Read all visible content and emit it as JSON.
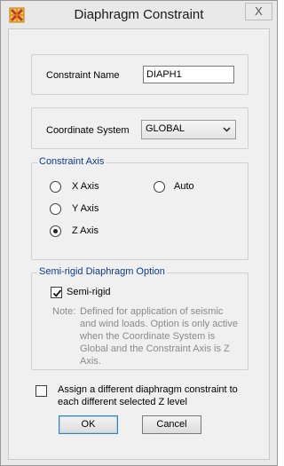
{
  "window": {
    "title": "Diaphragm Constraint",
    "close_glyph": "X",
    "icon": "app-icon"
  },
  "constraint_name": {
    "label": "Constraint Name",
    "value": "DIAPH1"
  },
  "coordinate_system": {
    "label": "Coordinate System",
    "selected": "GLOBAL"
  },
  "constraint_axis": {
    "title": "Constraint Axis",
    "options": [
      {
        "label": "X Axis",
        "selected": false
      },
      {
        "label": "Y Axis",
        "selected": false
      },
      {
        "label": "Z Axis",
        "selected": true
      },
      {
        "label": "Auto",
        "selected": false
      }
    ]
  },
  "semi_rigid": {
    "title": "Semi-rigid Diaphragm Option",
    "checkbox_label": "Semi-rigid",
    "checked": true,
    "note_label": "Note:",
    "note_lines": [
      "Defined for application of seismic",
      "and wind loads. Option is only active",
      "when the Coordinate System is",
      "Global and the Constraint Axis is Z",
      "Axis."
    ]
  },
  "z_level": {
    "checked": false,
    "label_lines": [
      "Assign a different diaphragm constraint to",
      "each different selected Z level"
    ]
  },
  "buttons": {
    "ok": "OK",
    "cancel": "Cancel"
  }
}
